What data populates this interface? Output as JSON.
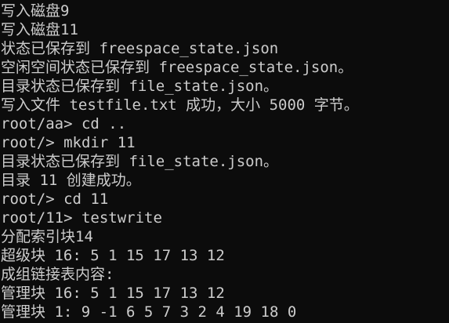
{
  "terminal": {
    "lines": [
      "写入磁盘9",
      "写入磁盘11",
      "状态已保存到 freespace_state.json",
      "空闲空间状态已保存到 freespace_state.json。",
      "目录状态已保存到 file_state.json。",
      "写入文件 testfile.txt 成功，大小 5000 字节。",
      "root/aa> cd ..",
      "root/> mkdir 11",
      "目录状态已保存到 file_state.json。",
      "目录 11 创建成功。",
      "root/> cd 11",
      "root/11> testwrite",
      "分配索引块14",
      "超级块 16: 5 1 15 17 13 12",
      "成组链接表内容:",
      "管理块 16: 5 1 15 17 13 12",
      "管理块 1: 9 -1 6 5 7 3 2 4 19 18 0"
    ]
  }
}
